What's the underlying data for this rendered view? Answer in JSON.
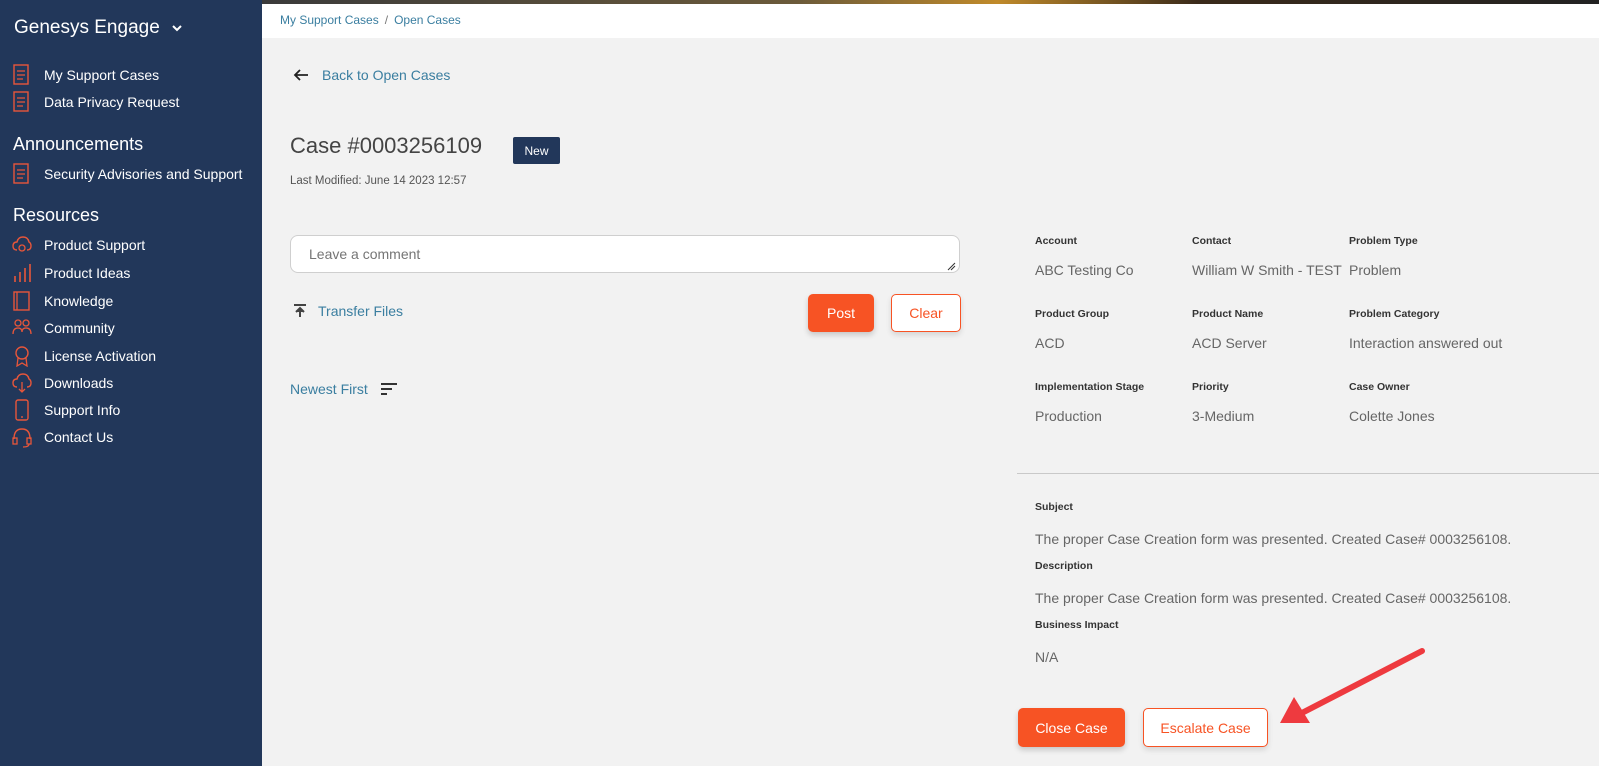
{
  "sidebar": {
    "brand": "Genesys Engage",
    "group1": [
      {
        "label": "My Support Cases",
        "icon": "document-icon"
      },
      {
        "label": "Data Privacy Request",
        "icon": "document-icon"
      }
    ],
    "announcements_title": "Announcements",
    "group2": [
      {
        "label": "Security Advisories and Support",
        "icon": "document-icon"
      }
    ],
    "resources_title": "Resources",
    "group3": [
      {
        "label": "Product Support",
        "icon": "cloud-gear-icon"
      },
      {
        "label": "Product Ideas",
        "icon": "bar-chart-icon"
      },
      {
        "label": "Knowledge",
        "icon": "book-icon"
      },
      {
        "label": "Community",
        "icon": "people-icon"
      },
      {
        "label": "License Activation",
        "icon": "award-icon"
      },
      {
        "label": "Downloads",
        "icon": "cloud-download-icon"
      },
      {
        "label": "Support Info",
        "icon": "phone-icon"
      },
      {
        "label": "Contact Us",
        "icon": "headset-icon"
      }
    ]
  },
  "breadcrumb": {
    "items": [
      "My Support Cases",
      "Open Cases"
    ],
    "separator": "/"
  },
  "case": {
    "back_label": "Back to Open Cases",
    "title": "Case #0003256109",
    "status": "New",
    "last_modified": "Last Modified: June 14 2023 12:57"
  },
  "comment": {
    "placeholder": "Leave a comment",
    "transfer_label": "Transfer Files",
    "post_label": "Post",
    "clear_label": "Clear",
    "sort_label": "Newest First"
  },
  "details": {
    "account": {
      "label": "Account",
      "value": "ABC Testing Co"
    },
    "contact": {
      "label": "Contact",
      "value": "William W Smith - TEST"
    },
    "problem_type": {
      "label": "Problem Type",
      "value": "Problem"
    },
    "product_group": {
      "label": "Product Group",
      "value": "ACD"
    },
    "product_name": {
      "label": "Product Name",
      "value": "ACD Server"
    },
    "problem_category": {
      "label": "Problem Category",
      "value": "Interaction answered out"
    },
    "implementation_stage": {
      "label": "Implementation Stage",
      "value": "Production"
    },
    "priority": {
      "label": "Priority",
      "value": "3-Medium"
    },
    "case_owner": {
      "label": "Case Owner",
      "value": "Colette Jones"
    },
    "subject": {
      "label": "Subject",
      "value": "The proper Case Creation form was presented. Created Case# 0003256108."
    },
    "description": {
      "label": "Description",
      "value": "The proper Case Creation form was presented. Created Case# 0003256108."
    },
    "business_impact": {
      "label": "Business Impact",
      "value": "N/A"
    }
  },
  "actions": {
    "close_label": "Close Case",
    "escalate_label": "Escalate Case"
  },
  "colors": {
    "sidebar": "#22375a",
    "accent": "#f75324",
    "link": "#3a7ea0",
    "annotation_arrow": "#ee3a3f"
  }
}
